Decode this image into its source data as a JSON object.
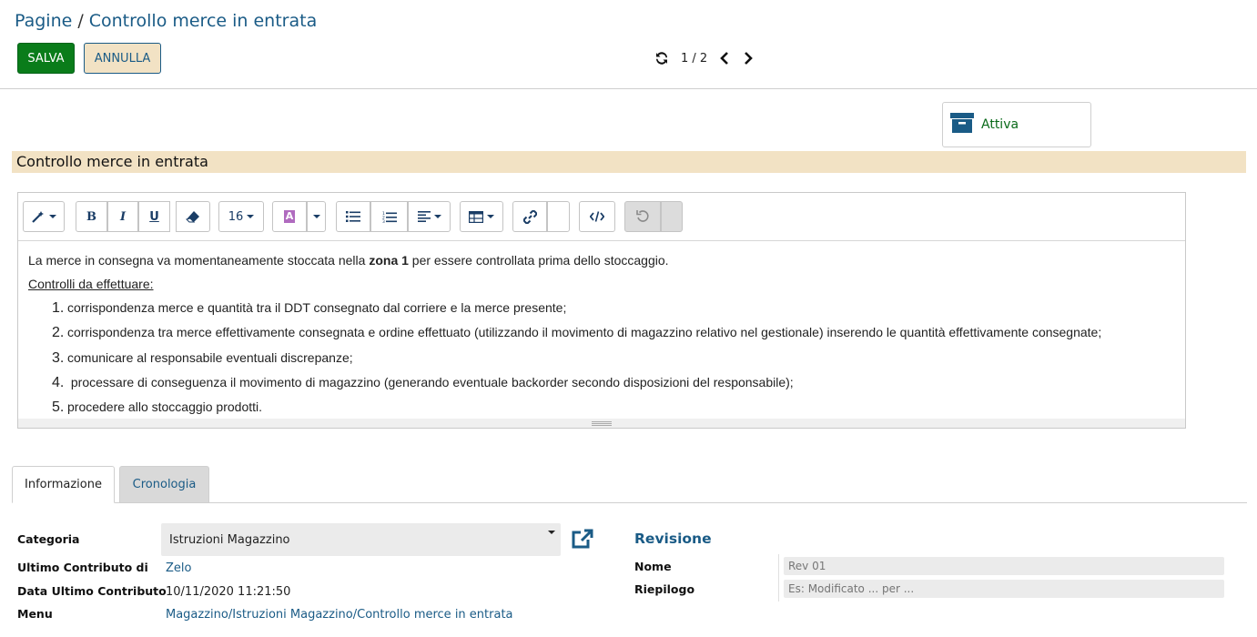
{
  "breadcrumb": {
    "root": "Pagine",
    "separator": "/",
    "current": "Controllo merce in entrata"
  },
  "actions": {
    "save_label": "SALVA",
    "cancel_label": "ANNULLA"
  },
  "pager": {
    "refresh_icon": "refresh-icon",
    "position": "1 / 2"
  },
  "status": {
    "icon": "archive-box-icon",
    "label": "Attiva"
  },
  "page_title": "Controllo merce in entrata",
  "editor": {
    "toolbar": {
      "font_size": "16"
    },
    "intro": {
      "before": "La merce in consegna va momentaneamente stoccata nella ",
      "bold": "zona 1",
      "after": " per essere controllata prima dello stoccaggio."
    },
    "subheading": "Controlli da effettuare:",
    "items": [
      {
        "num": "1.",
        "text": "corrispondenza merce e quantità tra il DDT consegnato dal corriere e la merce presente;"
      },
      {
        "num": "2.",
        "text": "corrispondenza tra merce effettivamente consegnata e ordine effettuato (utilizzando il movimento di magazzino relativo nel gestionale) inserendo le quantità effettivamente consegnate;"
      },
      {
        "num": "3.",
        "text": "comunicare al responsabile eventuali discrepanze;"
      },
      {
        "num": "4.",
        "text": " processare di conseguenza il movimento di magazzino (generando eventuale backorder secondo disposizioni del responsabile);"
      },
      {
        "num": "5.",
        "text": "procedere allo stoccaggio prodotti."
      }
    ]
  },
  "tabs": {
    "info": "Informazione",
    "history": "Cronologia"
  },
  "info": {
    "category_label": "Categoria",
    "category_value": "Istruzioni Magazzino",
    "last_contrib_by_label": "Ultimo Contributo di",
    "last_contrib_by_value": "Zelo",
    "last_contrib_date_label": "Data Ultimo Contributo",
    "last_contrib_date_value": "10/11/2020 11:21:50",
    "menu_label": "Menu",
    "menu_value": "Magazzino/Istruzioni Magazzino/Controllo merce in entrata"
  },
  "revision": {
    "title": "Revisione",
    "name_label": "Nome",
    "name_value": "Rev 01",
    "summary_label": "Riepilogo",
    "summary_placeholder": "Es: Modificato ... per ..."
  },
  "colors": {
    "brand_blue": "#1a5b86",
    "save_green": "#0a7c1a",
    "accent_beige": "#f2e2c4"
  }
}
